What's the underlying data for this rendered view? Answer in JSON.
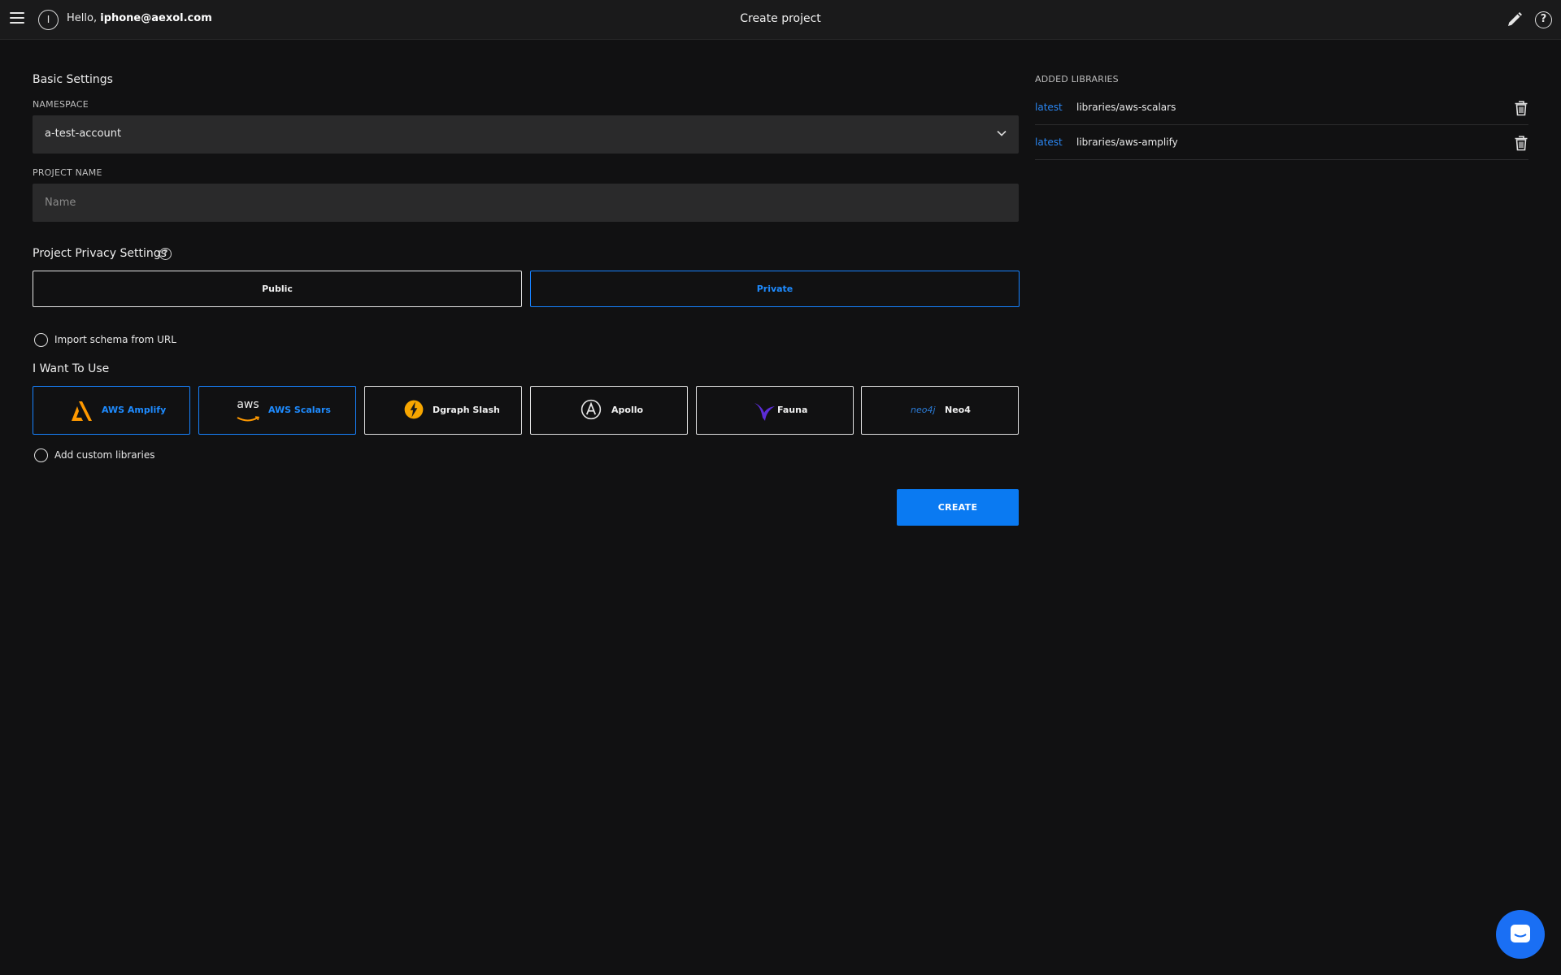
{
  "header": {
    "avatar_initial": "I",
    "greeting": "Hello,",
    "user_email": "iphone@aexol.com",
    "title": "Create project"
  },
  "basic_settings": {
    "heading": "Basic Settings",
    "namespace_label": "NAMESPACE",
    "namespace_value": "a-test-account",
    "project_name_label": "PROJECT NAME",
    "project_name_placeholder": "Name",
    "project_name_value": ""
  },
  "privacy": {
    "heading": "Project Privacy Settings",
    "help_glyph": "?",
    "options": [
      {
        "label": "Public",
        "selected": false
      },
      {
        "label": "Private",
        "selected": true
      }
    ]
  },
  "import_schema": {
    "label": "Import schema from URL",
    "checked": false
  },
  "want_to_use": {
    "heading": "I Want To Use",
    "libraries": [
      {
        "name": "AWS Amplify",
        "icon": "aws-amplify-icon",
        "selected": true
      },
      {
        "name": "AWS Scalars",
        "icon": "aws-icon",
        "selected": true
      },
      {
        "name": "Dgraph Slash",
        "icon": "dgraph-icon",
        "selected": false
      },
      {
        "name": "Apollo",
        "icon": "apollo-icon",
        "selected": false
      },
      {
        "name": "Fauna",
        "icon": "fauna-icon",
        "selected": false
      },
      {
        "name": "Neo4",
        "icon": "neo4j-icon",
        "selected": false
      }
    ],
    "aws_logo_text": "aws",
    "neo4j_logo_text": "neo4j"
  },
  "custom_libraries": {
    "label": "Add custom libraries",
    "checked": false
  },
  "actions": {
    "create_label": "CREATE"
  },
  "added_libraries": {
    "title": "ADDED LIBRARIES",
    "items": [
      {
        "version": "latest",
        "name": "libraries/aws-scalars"
      },
      {
        "version": "latest",
        "name": "libraries/aws-amplify"
      }
    ]
  },
  "colors": {
    "accent": "#1782ff",
    "background": "#111112",
    "topbar": "#1a1a1b",
    "input_bg": "#2a2a2b",
    "create_button": "#0a7af2"
  }
}
